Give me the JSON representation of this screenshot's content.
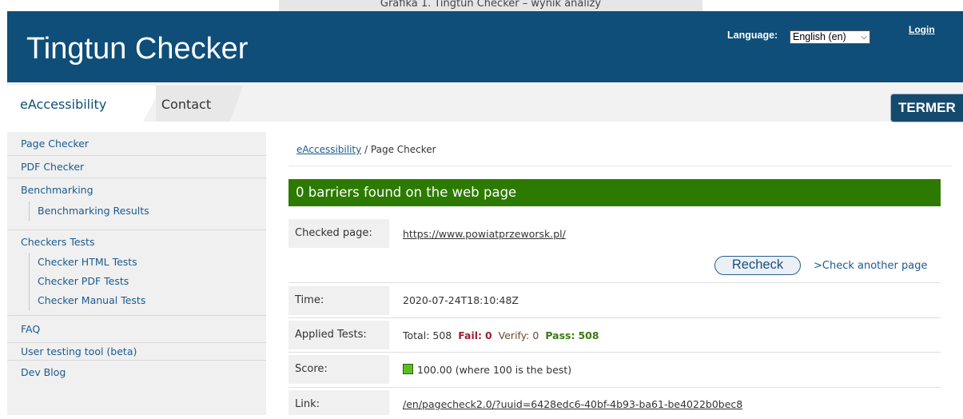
{
  "caption": "Grafika 1. Tingtun Checker – wynik analizy",
  "header": {
    "title": "Tingtun Checker",
    "language_label": "Language:",
    "language_value": "English (en)",
    "login": "Login"
  },
  "tabs": [
    {
      "label": "eAccessibility"
    },
    {
      "label": "Contact"
    }
  ],
  "termer_label": "TERMER",
  "sidebar": {
    "items": [
      {
        "label": "Page Checker"
      },
      {
        "label": "PDF Checker"
      },
      {
        "label": "Benchmarking",
        "children": [
          "Benchmarking Results"
        ]
      },
      {
        "label": "Checkers Tests",
        "children": [
          "Checker HTML Tests",
          "Checker PDF Tests",
          "Checker Manual Tests"
        ]
      },
      {
        "label": "FAQ"
      },
      {
        "label": "User testing tool (beta)"
      },
      {
        "label": "Dev Blog"
      }
    ]
  },
  "breadcrumb": {
    "link": "eAccessibility",
    "separator": " / ",
    "current": "Page Checker"
  },
  "result": {
    "banner": "0 barriers found on the web page",
    "checked_page_label": "Checked page:",
    "checked_page_url": "https://www.powiatprzeworsk.pl/",
    "recheck_label": "Recheck",
    "check_another_label": ">Check another page",
    "time_label": "Time:",
    "time_value": "2020-07-24T18:10:48Z",
    "applied_label": "Applied Tests:",
    "tests": {
      "total_label": "Total:",
      "total": "508",
      "fail_label": "Fail:",
      "fail": "0",
      "verify_label": "Verify:",
      "verify": "0",
      "pass_label": "Pass:",
      "pass": "508"
    },
    "score_label": "Score:",
    "score_value": "100.00",
    "score_note": "(where 100 is the best)",
    "link_label": "Link:",
    "link_value": "/en/pagecheck2.0/?uuid=6428edc6-40bf-4b93-ba61-be4022b0bec8"
  },
  "colors": {
    "header_bg": "#0e4e79",
    "banner_green": "#2c7a00",
    "link_blue": "#1b5a8f",
    "score_square": "#5cbe1e"
  }
}
